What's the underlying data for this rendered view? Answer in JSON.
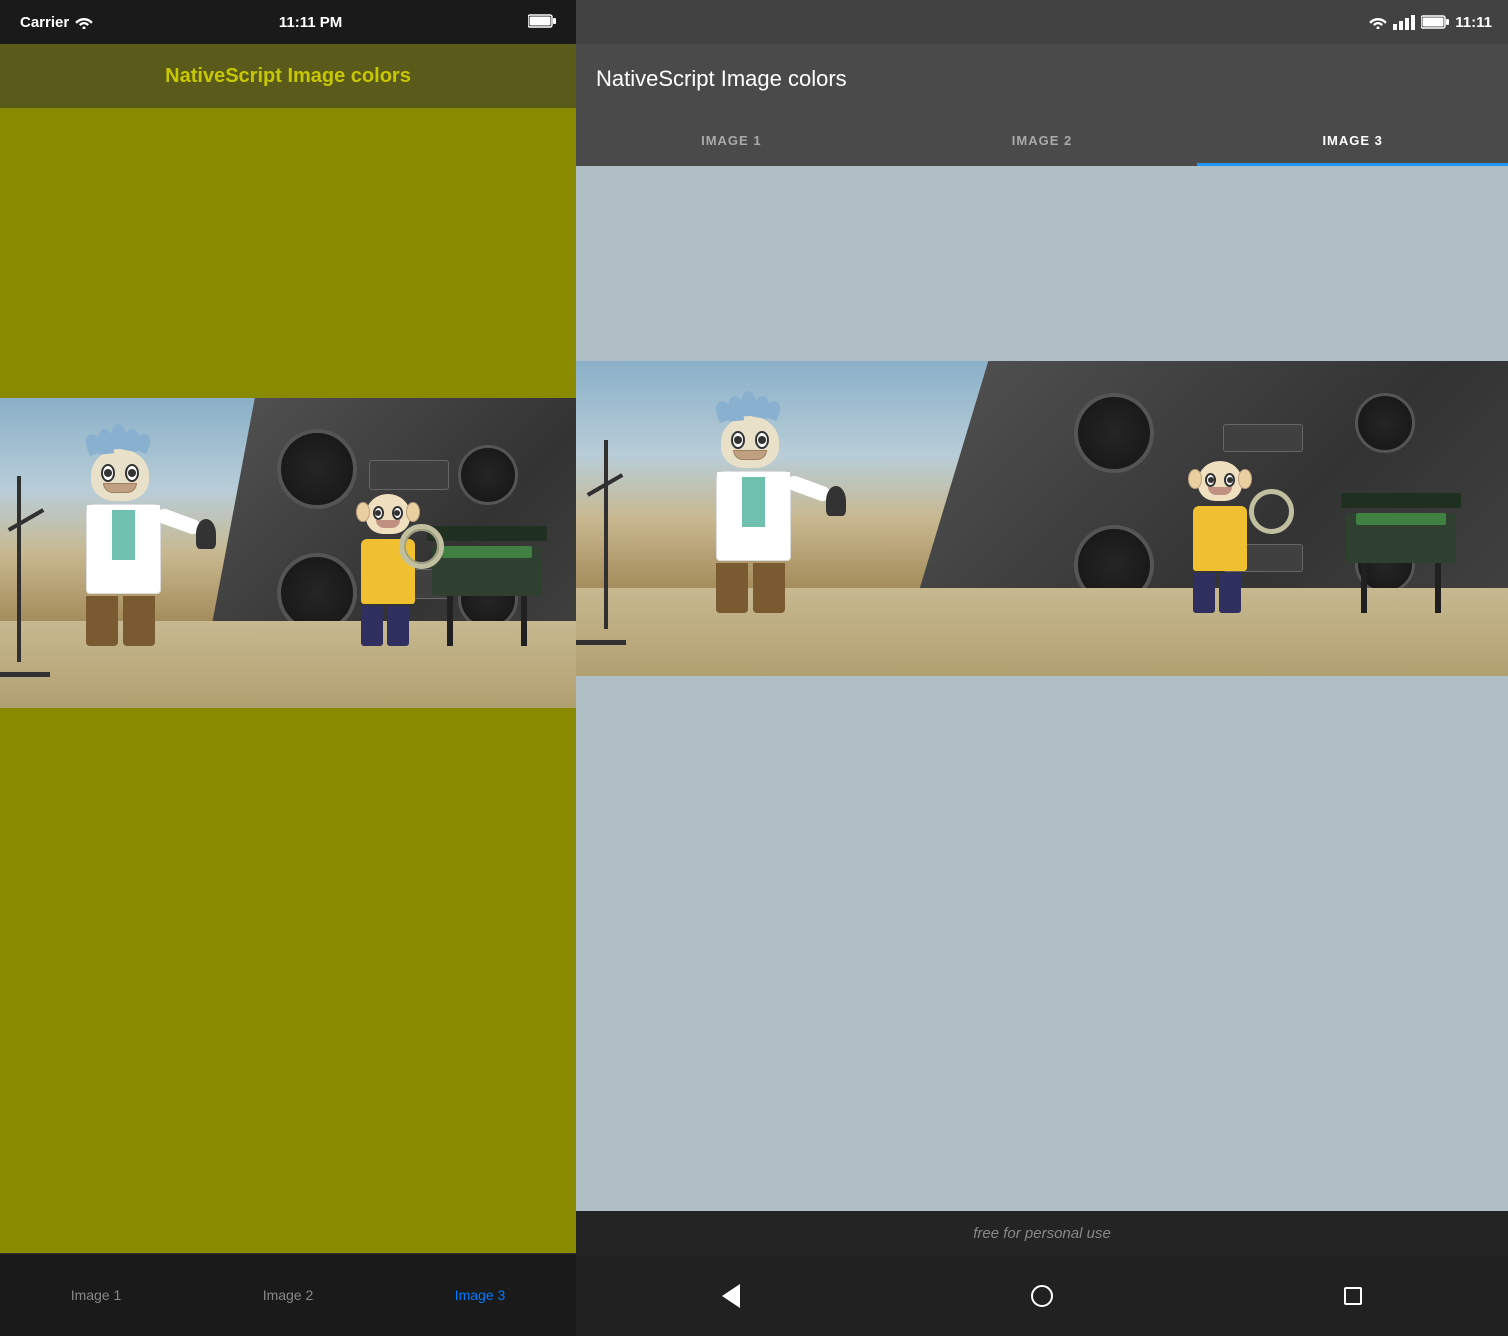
{
  "ios": {
    "status_bar": {
      "carrier": "Carrier",
      "time": "11:11 PM"
    },
    "header": {
      "title": "NativeScript Image colors"
    },
    "tabs": [
      {
        "label": "Image 1",
        "active": false
      },
      {
        "label": "Image 2",
        "active": false
      },
      {
        "label": "Image 3",
        "active": true
      }
    ],
    "background_color": "#8a8a00",
    "header_color": "#5a5a1a",
    "title_color": "#c8c800"
  },
  "android": {
    "status_bar": {
      "time": "11:11"
    },
    "header": {
      "title": "NativeScript Image colors"
    },
    "tabs": [
      {
        "label": "IMAGE 1",
        "active": false
      },
      {
        "label": "IMAGE 2",
        "active": false
      },
      {
        "label": "IMAGE 3",
        "active": true
      }
    ],
    "background_color": "#b0bec5",
    "header_color": "#4a4a4a"
  },
  "watermark": {
    "text": "free for personal use"
  }
}
